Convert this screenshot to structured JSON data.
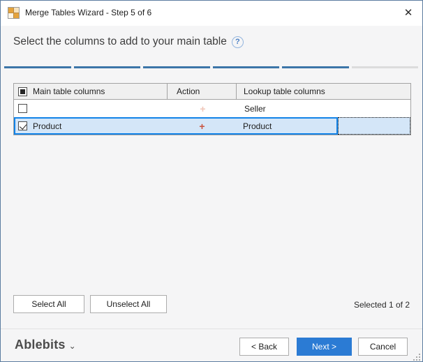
{
  "window": {
    "title": "Merge Tables Wizard - Step 5 of 6",
    "close_glyph": "✕"
  },
  "header": {
    "heading": "Select the columns to add to your main table",
    "help_glyph": "?"
  },
  "progress": {
    "current_step": 5,
    "total_steps": 6,
    "active_color": "#3c76a8",
    "inactive_color": "#dcdcdc"
  },
  "table": {
    "columns": [
      "Main table columns",
      "Action",
      "Lookup table columns"
    ],
    "rows": [
      {
        "checked": false,
        "selected": false,
        "main": "",
        "action": "+",
        "lookup": "Seller"
      },
      {
        "checked": true,
        "selected": true,
        "main": "Product",
        "action": "+",
        "lookup": "Product"
      }
    ],
    "header_checkbox_state": "indeterminate",
    "selection_border_color": "#1283e8",
    "selection_fill_color": "#d4e6f8",
    "action_plus_active_color": "#c9543f",
    "action_plus_inactive_color": "#f0c6b8"
  },
  "actions": {
    "select_all": "Select All",
    "unselect_all": "Unselect All",
    "selected_status": "Selected 1 of 2"
  },
  "footer": {
    "brand": "Ablebits",
    "brand_chevron": "⌄",
    "back": "< Back",
    "next": "Next >",
    "cancel": "Cancel",
    "next_button_color": "#2b7bd4"
  }
}
